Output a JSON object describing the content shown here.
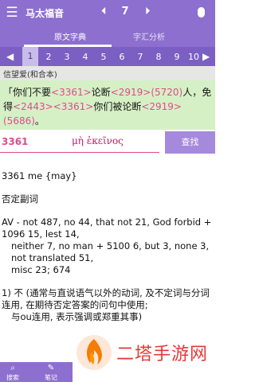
{
  "header": {
    "title": "马太福音",
    "chapter": "7",
    "prev": "⏴",
    "next": "⏵"
  },
  "tabs": [
    {
      "label": "原文字典"
    },
    {
      "label": "字汇分析"
    }
  ],
  "verses": [
    "1",
    "2",
    "3",
    "4",
    "5",
    "6",
    "7",
    "8",
    "9",
    "10"
  ],
  "active_verse": "1",
  "version": "信望爱(和合本)",
  "verse_text": {
    "p1": "「你们不要",
    "r1": "<3361>",
    "p2": "论断",
    "r2": "<2919>(5720)",
    "p3": "人，免得",
    "r3": "<2443><3361>",
    "p4": "你们被论断",
    "r4": "<2919>(5686)",
    "p5": "。"
  },
  "lookup": {
    "number": "3361",
    "greek": "μὴ ἐκεῖνος",
    "search_label": "查找"
  },
  "definition": {
    "line1": "3361 me {may}",
    "line2": "否定副词",
    "line3": "AV - not 487, no 44, that not 21, God forbid + 1096 15, lest 14,",
    "line4": "neither 7, no man + 5100 6, but 3, none 3, not translated 51,",
    "line5": "misc 23; 674",
    "line6": "1) 不 (通常与直说语气以外的动词, 及不定词与分词连用, 在期待否定答案的问句中使用;",
    "line7": "与ou连用, 表示强调或郑重其事)"
  },
  "bottom": [
    {
      "label": "搜索",
      "icon": "search-icon"
    },
    {
      "label": "笔记",
      "icon": "note-icon"
    }
  ],
  "watermark": {
    "text": "二塔手游网"
  },
  "colors": {
    "primary": "#8d6fcf",
    "verse_bg": "#d6f0c6",
    "ref": "#e04a8c"
  }
}
